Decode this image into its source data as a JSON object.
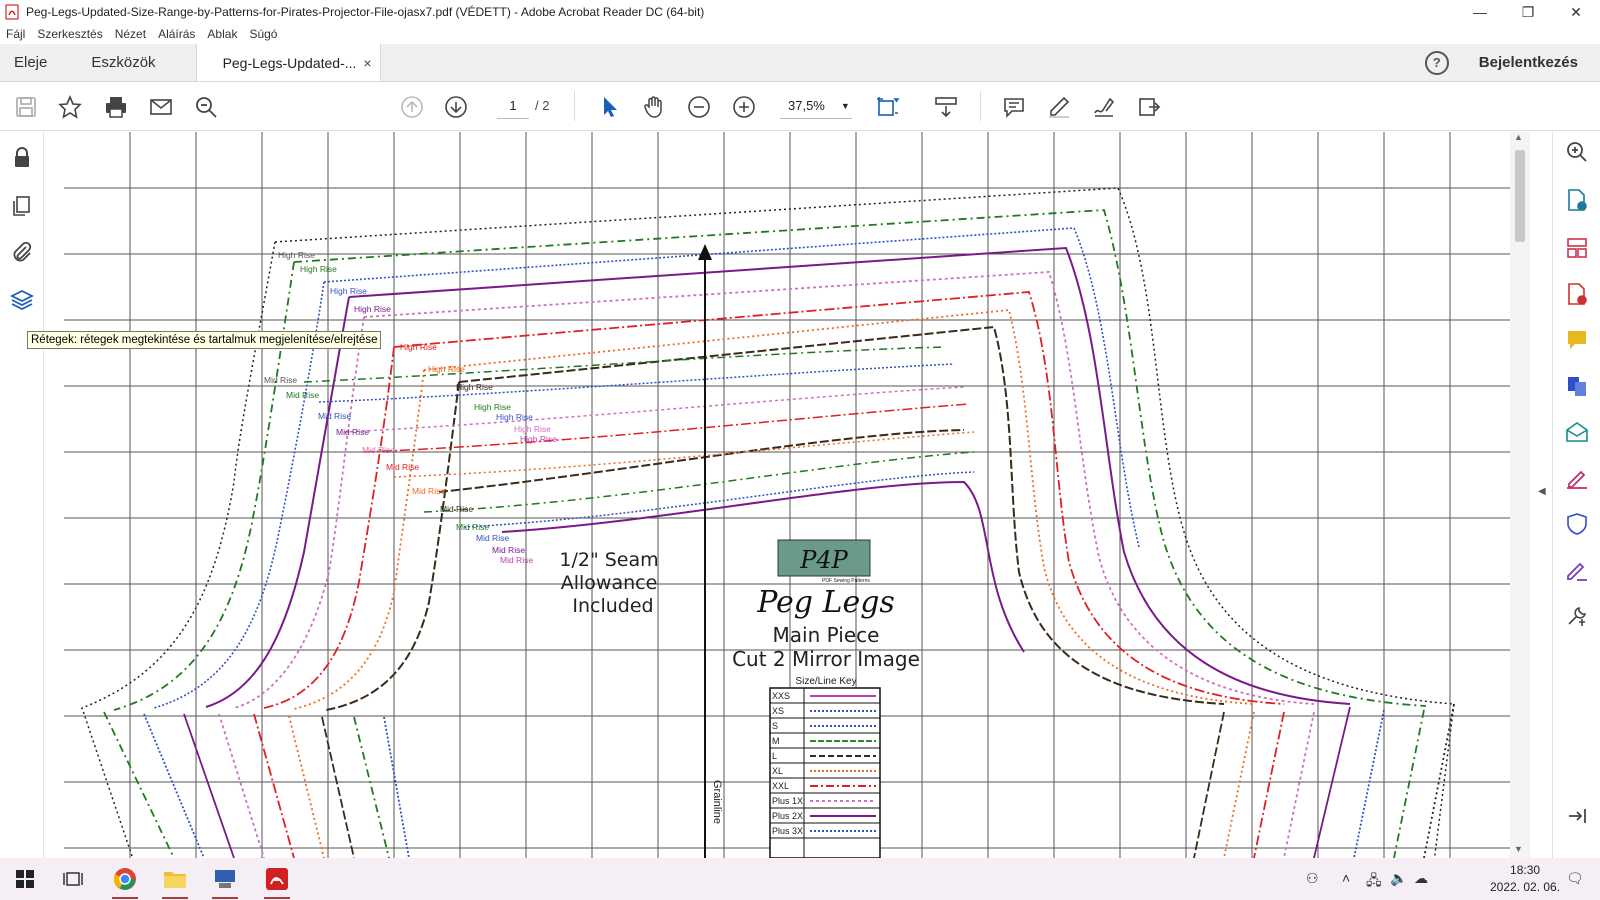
{
  "window": {
    "title": "Peg-Legs-Updated-Size-Range-by-Patterns-for-Pirates-Projector-File-ojasx7.pdf (VÉDETT) - Adobe Acrobat Reader DC (64-bit)",
    "minimize": "—",
    "restore": "❐",
    "close": "✕"
  },
  "menu": [
    "Fájl",
    "Szerkesztés",
    "Nézet",
    "Aláírás",
    "Ablak",
    "Súgó"
  ],
  "tabs": {
    "home": "Eleje",
    "tools": "Eszközök",
    "document": "Peg-Legs-Updated-...",
    "document_close": "×",
    "help": "?",
    "login": "Bejelentkezés"
  },
  "toolbar": {
    "page_current": "1",
    "page_total": "/ 2",
    "zoom": "37,5%",
    "zoom_caret": "▼"
  },
  "tooltip": "Rétegek: rétegek megtekintése és tartalmuk megjelenítése/elrejtése",
  "document": {
    "rise_labels_high": "High Rise",
    "rise_labels_mid": "Mid Rise",
    "seam_note": [
      "1/2\" Seam",
      "Allowance",
      "Included"
    ],
    "brand": "P4P",
    "brand_sub": "PDF Sewing Patterns",
    "pattern_name": "Peg Legs",
    "piece_name": "Main Piece",
    "cut_note": "Cut 2 Mirror Image",
    "key_title": "Size/Line Key",
    "grainline": "Grainline",
    "sizes": [
      {
        "label": "XXS",
        "color": "#c040b0"
      },
      {
        "label": "XS",
        "color": "#3050c8"
      },
      {
        "label": "S",
        "color": "#3050c8"
      },
      {
        "label": "M",
        "color": "#2a8a2a"
      },
      {
        "label": "L",
        "color": "#3a2a1a"
      },
      {
        "label": "XL",
        "color": "#f06a1a"
      },
      {
        "label": "XXL",
        "color": "#e02020"
      },
      {
        "label": "Plus 1X",
        "color": "#d070c0"
      },
      {
        "label": "Plus 2X",
        "color": "#7a1a8a"
      },
      {
        "label": "Plus 3X",
        "color": "#3050c8"
      }
    ]
  },
  "taskbar": {
    "time": "18:30",
    "date": "2022. 02. 06."
  }
}
